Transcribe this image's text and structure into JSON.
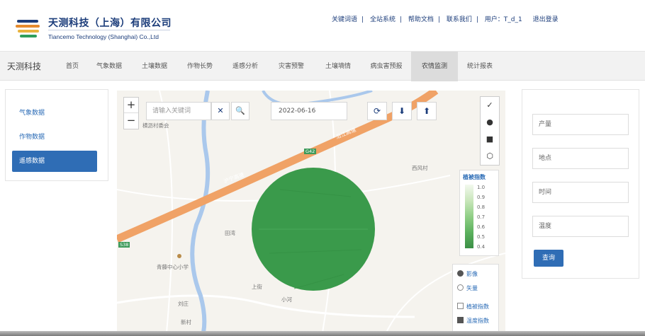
{
  "header": {
    "brand_cn": "天测科技（上海）有限公司",
    "brand_en": "Tiancemo Technology (Shanghai) Co.,Ltd",
    "links": [
      "关键词语",
      "全站系统",
      "帮助文档",
      "联系我们",
      "用户：T_d_1",
      "退出登录"
    ]
  },
  "nav": {
    "title": "天测科技",
    "items": [
      "首页",
      "气象数据",
      "土壤数据",
      "作物长势",
      "遥感分析",
      "灾害预警",
      "土壤墒情",
      "病虫害预报",
      "农情监测",
      "统计报表"
    ],
    "active_index": 8
  },
  "leftmenu": {
    "items": [
      "气象数据",
      "作物数据",
      "遥感数据"
    ],
    "active_index": 2
  },
  "map": {
    "zoom_in": "+",
    "zoom_out": "−",
    "search_placeholder": "请输入关键词",
    "clear_icon": "✕",
    "search_icon": "🔍",
    "date_value": "2022-06-16",
    "refresh_icon": "⟳",
    "download_icon": "⬇",
    "upload_icon": "⬆",
    "draw_tools": [
      "✓",
      "●",
      "■",
      "⬡"
    ],
    "legend": {
      "title": "植被指数",
      "ticks": [
        "1.0",
        "0.9",
        "0.8",
        "0.7",
        "0.6",
        "0.5",
        "0.4"
      ]
    },
    "layers": [
      {
        "label": "影像",
        "checked": true,
        "radio": true
      },
      {
        "label": "矢量",
        "checked": false,
        "radio": true
      },
      {
        "label": "植被指数",
        "checked": false,
        "radio": false
      },
      {
        "label": "温度指数",
        "checked": true,
        "radio": false
      }
    ],
    "labels": {
      "village_top": "横沥村委会",
      "road_main": "沪宁高速",
      "road_branch": "沿江高速",
      "place_1": "田湾",
      "place_2": "西风村",
      "school": "青藤中心小学",
      "place_3": "上街",
      "place_4": "小河",
      "place_5": "刘庄",
      "place_6": "新村",
      "tag_1": "G42",
      "tag_2": "S38"
    }
  },
  "form": {
    "fields": [
      "产量",
      "地点",
      "时间",
      "温度"
    ],
    "submit_label": "查询"
  },
  "colors": {
    "primary": "#2f6db5",
    "brand": "#1b3c7a",
    "road": "#f0a266",
    "river": "#aac8ec",
    "overlay": "#3a9a4b"
  }
}
